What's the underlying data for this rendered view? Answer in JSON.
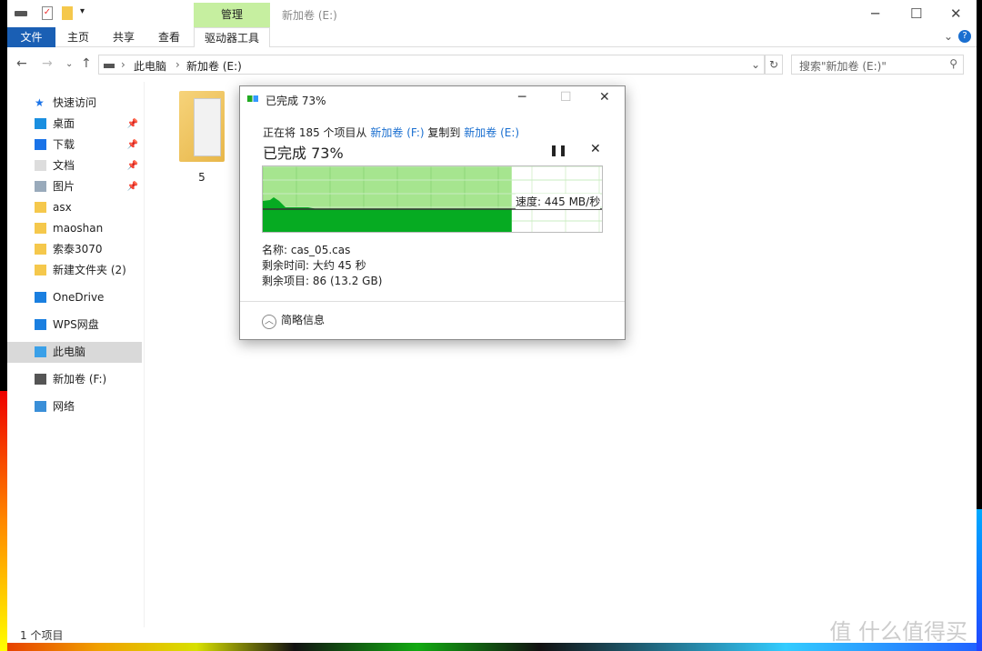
{
  "window": {
    "title": "新加卷 (E:)",
    "ribbon_context": "管理",
    "tabs": [
      "文件",
      "主页",
      "共享",
      "查看",
      "驱动器工具"
    ]
  },
  "address": {
    "crumbs": [
      "此电脑",
      "新加卷 (E:)"
    ],
    "search_placeholder": "搜索\"新加卷 (E:)\""
  },
  "sidebar": {
    "items": [
      {
        "label": "快速访问",
        "icon": "star-icon",
        "pin": false
      },
      {
        "label": "桌面",
        "icon": "desktop-icon",
        "pin": true
      },
      {
        "label": "下载",
        "icon": "download-icon",
        "pin": true
      },
      {
        "label": "文档",
        "icon": "document-icon",
        "pin": true
      },
      {
        "label": "图片",
        "icon": "picture-icon",
        "pin": true
      },
      {
        "label": "asx",
        "icon": "folder-icon",
        "pin": false
      },
      {
        "label": "maoshan",
        "icon": "folder-icon",
        "pin": false
      },
      {
        "label": "索泰3070",
        "icon": "folder-icon",
        "pin": false
      },
      {
        "label": "新建文件夹 (2)",
        "icon": "folder-icon",
        "pin": false
      },
      {
        "label": "OneDrive",
        "icon": "cloud-icon",
        "pin": false
      },
      {
        "label": "WPS网盘",
        "icon": "cloud-icon",
        "pin": false
      },
      {
        "label": "此电脑",
        "icon": "computer-icon",
        "pin": false,
        "selected": true
      },
      {
        "label": "新加卷 (F:)",
        "icon": "drive-icon",
        "pin": false
      },
      {
        "label": "网络",
        "icon": "network-icon",
        "pin": false
      }
    ]
  },
  "content": {
    "folder_name": "5"
  },
  "status": {
    "count": "1 个项目"
  },
  "watermark": "值 什么值得买",
  "dialog": {
    "title": "已完成 73%",
    "line_prefix": "正在将 185 个项目从",
    "source": "新加卷 (F:)",
    "line_mid": "复制到",
    "dest": "新加卷 (E:)",
    "progress_text": "已完成 73%",
    "progress": 0.73,
    "speed": "速度: 445 MB/秒",
    "name": "名称: cas_05.cas",
    "time_left": "剩余时间: 大约 45 秒",
    "items_left": "剩余项目: 86 (13.2 GB)",
    "fewer_details": "简略信息",
    "colors": {
      "done": "#a6e58f",
      "speed": "#06ab22"
    }
  }
}
